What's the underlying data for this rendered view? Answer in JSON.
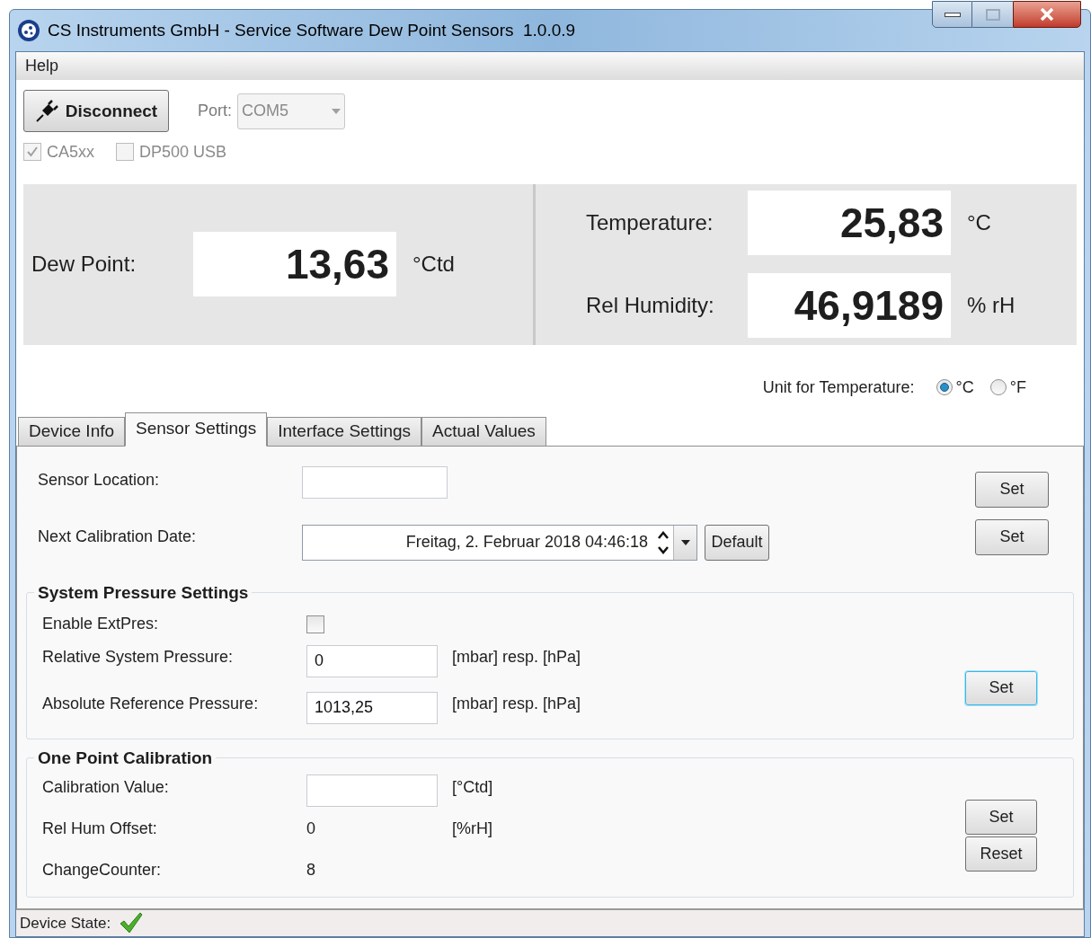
{
  "window": {
    "title": "CS Instruments GmbH - Service Software Dew Point Sensors  1.0.0.9"
  },
  "menu": [
    {
      "label": "Help"
    }
  ],
  "connection": {
    "button": "Disconnect",
    "port_label": "Port:",
    "port_value": "COM5",
    "disabled": true
  },
  "device_types": [
    {
      "label": "CA5xx",
      "checked": true,
      "disabled": true
    },
    {
      "label": "DP500 USB",
      "checked": false,
      "disabled": true
    }
  ],
  "dew_point": {
    "label": "Dew Point:",
    "value": "13,63",
    "unit": "°Ctd"
  },
  "readings": [
    {
      "label": "Temperature:",
      "value": "25,83",
      "unit": "°C"
    },
    {
      "label": "Rel Humidity:",
      "value": "46,9189",
      "unit": "% rH"
    }
  ],
  "unit_for_temperature": {
    "label": "Unit for Temperature:",
    "options": [
      {
        "label": "°C",
        "selected": true
      },
      {
        "label": "°F",
        "selected": false
      }
    ]
  },
  "tabs": [
    {
      "label": "Device Info",
      "selected": false
    },
    {
      "label": "Sensor Settings",
      "selected": true
    },
    {
      "label": "Interface Settings",
      "selected": false
    },
    {
      "label": "Actual Values",
      "selected": false
    }
  ],
  "sensor_location": {
    "label": "Sensor Location:",
    "button": "Set"
  },
  "next_calibration_date": {
    "label": "Next Calibration Date:",
    "value": "Freitag, 2. Februar 2018 04:46:18",
    "default_button": "Default",
    "button": "Set"
  },
  "system_pressure": {
    "title": "System Pressure Settings",
    "enable": {
      "label": "Enable ExtPres:",
      "checked": false
    },
    "fields": [
      {
        "label": "Relative System Pressure:",
        "value": "0",
        "unit": "[mbar] resp. [hPa]"
      },
      {
        "label": "Absolute Reference Pressure:",
        "value": "1013,25",
        "unit": "[mbar] resp. [hPa]"
      }
    ],
    "button": {
      "label": "Set",
      "focused": true
    }
  },
  "one_point_calibration": {
    "title": "One Point Calibration",
    "calibration_value": {
      "label": "Calibration Value:",
      "unit": "[°Ctd]"
    },
    "readouts": [
      {
        "label": "Rel Hum Offset:",
        "value": "0",
        "unit": "[%rH]"
      },
      {
        "label": "ChangeCounter:",
        "value": "8"
      }
    ],
    "buttons": [
      {
        "label": "Set"
      },
      {
        "label": "Reset"
      }
    ]
  },
  "status_bar": {
    "label": "Device State:",
    "ok": true
  }
}
